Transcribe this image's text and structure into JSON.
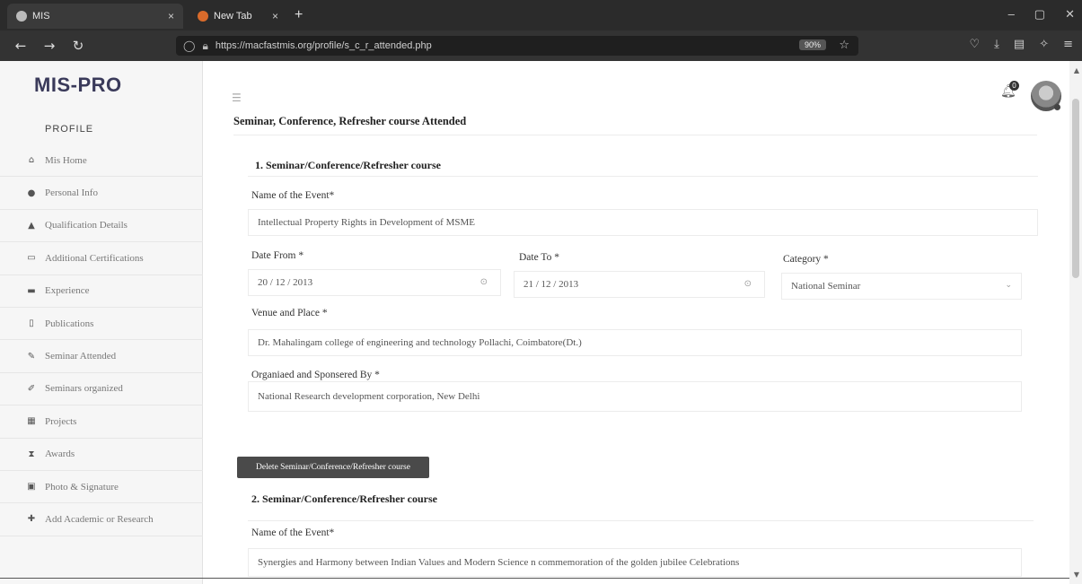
{
  "browser": {
    "tabs": [
      {
        "label": "MIS",
        "close": "×"
      },
      {
        "label": "New Tab",
        "close": "×"
      }
    ],
    "new_tab": "+",
    "url": "https://macfastmis.org/profile/s_c_r_attended.php",
    "zoom": "90%",
    "nav": {
      "back": "←",
      "forward": "→",
      "reload": "↻"
    }
  },
  "sidebar": {
    "logo": "MIS-PRO",
    "heading": "PROFILE",
    "items": [
      {
        "label": "Mis Home",
        "icon": "home-icon"
      },
      {
        "label": "Personal Info",
        "icon": "user-icon"
      },
      {
        "label": "Qualification Details",
        "icon": "graduation-cap-icon"
      },
      {
        "label": "Additional Certifications",
        "icon": "certificate-icon"
      },
      {
        "label": "Experience",
        "icon": "briefcase-icon"
      },
      {
        "label": "Publications",
        "icon": "document-icon"
      },
      {
        "label": "Seminar Attended",
        "icon": "pin-icon"
      },
      {
        "label": "Seminars organized",
        "icon": "pencil-icon"
      },
      {
        "label": "Projects",
        "icon": "projects-icon"
      },
      {
        "label": "Awards",
        "icon": "trophy-icon"
      },
      {
        "label": "Photo & Signature",
        "icon": "photo-icon"
      },
      {
        "label": "Add Academic or Research",
        "icon": "plus-icon"
      }
    ]
  },
  "header": {
    "notification_count": "0"
  },
  "page": {
    "title": "Seminar, Conference, Refresher course Attended",
    "entry1": {
      "heading": "1. Seminar/Conference/Refresher course",
      "name_label": "Name of the Event*",
      "name_value": "Intellectual Property Rights in Development of MSME",
      "date_from_label": "Date From *",
      "date_from_value": "20 / 12 / 2013",
      "date_to_label": "Date To *",
      "date_to_value": "21 / 12 / 2013",
      "category_label": "Category *",
      "category_value": "National Seminar",
      "venue_label": "Venue and Place *",
      "venue_value": "Dr. Mahalingam college of engineering and technology Pollachi, Coimbatore(Dt.)",
      "organised_label": "Organiaed and Sponsered By *",
      "organised_value": "National Research development corporation, New Delhi",
      "delete_button": "Delete Seminar/Conference/Refresher course"
    },
    "entry2": {
      "heading": "2. Seminar/Conference/Refresher course",
      "name_label": "Name of the Event*",
      "name_value": "Synergies and Harmony between Indian Values and Modern Science n commemoration of the golden jubilee Celebrations"
    }
  }
}
